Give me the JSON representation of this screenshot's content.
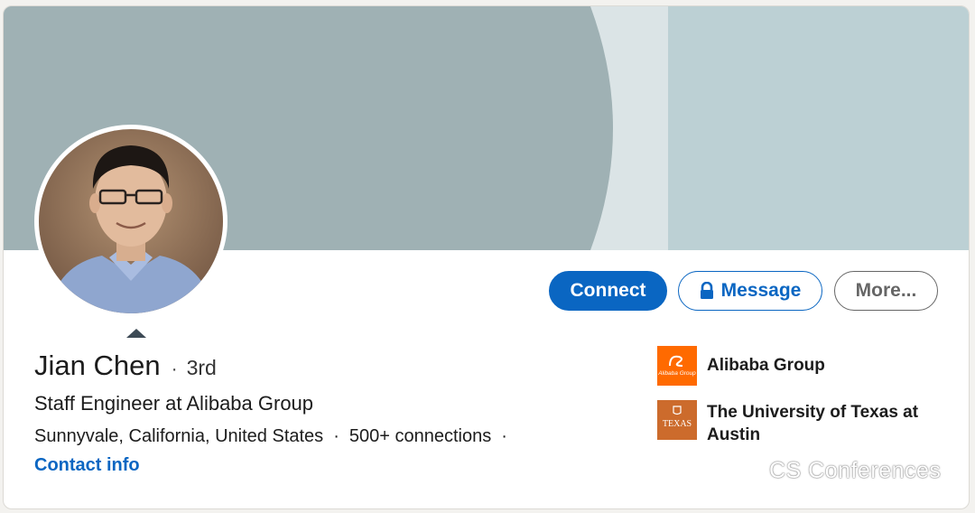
{
  "profile": {
    "name": "Jian Chen",
    "degree_separator": "·",
    "degree": "3rd",
    "headline": "Staff Engineer at Alibaba Group",
    "location": "Sunnyvale, California, United States",
    "separator": "·",
    "connections": "500+ connections",
    "contact_info": "Contact info"
  },
  "actions": {
    "connect_label": "Connect",
    "message_label": "Message",
    "more_label": "More..."
  },
  "organizations": [
    {
      "name": "Alibaba Group",
      "logo_text": "Alibaba Group",
      "logo_color": "#ff6a00",
      "icon": "alibaba-logo"
    },
    {
      "name": "The University of Texas at Austin",
      "logo_text": "TEXAS",
      "logo_color": "#cc6b2c",
      "icon": "ut-austin-logo"
    }
  ],
  "watermark": {
    "text": "CS Conferences",
    "icon": "wechat-icon"
  },
  "colors": {
    "brand_blue": "#0a66c2",
    "banner_main": "#9fb1b4",
    "banner_stripe": "#dbe4e6",
    "banner_right": "#bcd0d4"
  }
}
